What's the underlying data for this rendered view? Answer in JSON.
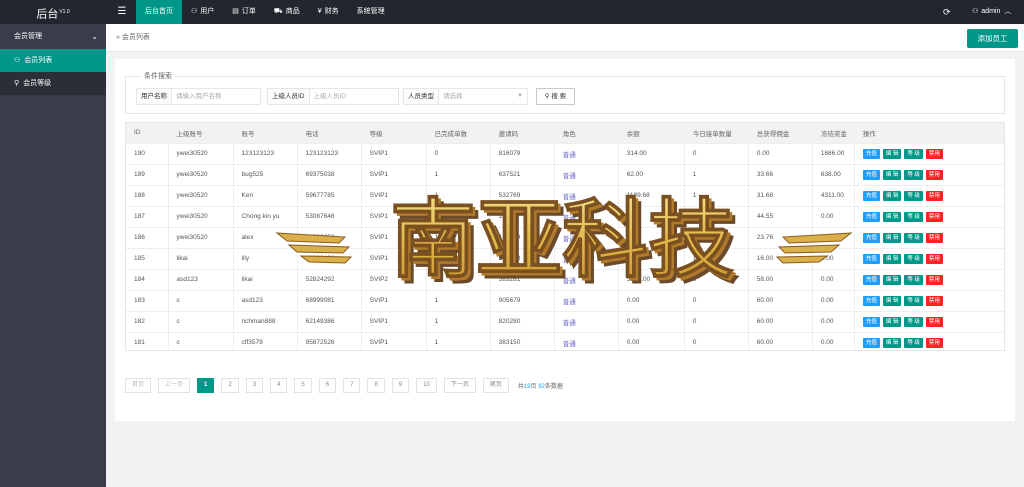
{
  "brand": {
    "name": "后台",
    "version": "V1.0"
  },
  "topnav": {
    "toggle_icon": "menu-icon",
    "items": [
      {
        "label": "后台首页",
        "active": true,
        "icon": ""
      },
      {
        "label": "用户",
        "active": false,
        "icon": "user-icon"
      },
      {
        "label": "订单",
        "active": false,
        "icon": "doc-icon"
      },
      {
        "label": "商品",
        "active": false,
        "icon": "cart-icon"
      },
      {
        "label": "财务",
        "active": false,
        "icon": "yen-icon"
      },
      {
        "label": "系统管理",
        "active": false,
        "icon": ""
      }
    ],
    "refresh_icon": "refresh-icon",
    "user": "admin"
  },
  "sidebar": {
    "group": "会员管理",
    "items": [
      {
        "label": "会员列表",
        "active": true,
        "icon": "user-icon"
      },
      {
        "label": "会员等级",
        "active": false,
        "icon": "key-icon"
      }
    ]
  },
  "breadcrumb": {
    "sep": "»",
    "label": "会员列表"
  },
  "toolbar": {
    "add_label": "添加员工"
  },
  "search": {
    "legend": "条件搜索",
    "username_label": "用户名称",
    "username_placeholder": "请输入用户名称",
    "parent_label": "上级人员ID",
    "parent_placeholder": "上级人员ID",
    "type_label": "人员类型",
    "type_placeholder": "请选择",
    "search_button": "搜 索"
  },
  "table": {
    "columns": [
      "ID",
      "上级账号",
      "账号",
      "电话",
      "等级",
      "已完成单数",
      "邀请码",
      "角色",
      "余额",
      "今日接单数量",
      "总获得佣金",
      "冻结资金",
      "操作"
    ],
    "actions": [
      "充值",
      "编 辑",
      "等 级",
      "禁用"
    ],
    "rows": [
      [
        "190",
        "ywei30520",
        "123123123",
        "123123123",
        "SVIP1",
        "0",
        "816079",
        "普通",
        "314.00",
        "0",
        "0.00",
        "1686.00"
      ],
      [
        "189",
        "ywei30520",
        "bug525",
        "69375038",
        "SVIP1",
        "1",
        "637521",
        "普通",
        "62.00",
        "1",
        "33.66",
        "638.00"
      ],
      [
        "188",
        "ywei30520",
        "Ken",
        "59677785",
        "SVIP1",
        "1",
        "532769",
        "普通",
        "1189.68",
        "1",
        "31.68",
        "4311.00"
      ],
      [
        "187",
        "ywei30520",
        "Chong kin yu",
        "53087646",
        "SVIP1",
        "3",
        "111111",
        "普通",
        "0.00",
        "3",
        "44.55",
        "0.00"
      ],
      [
        "186",
        "ywei30520",
        "alex",
        "53700050",
        "SVIP1",
        "1",
        "180039",
        "普通",
        "0.00",
        "1",
        "23.76",
        "0.00"
      ],
      [
        "185",
        "likai",
        "lily",
        "68838131",
        "SVIP1",
        "1",
        "246928",
        "普通",
        "19.86",
        "1",
        "16.00",
        "0.00"
      ],
      [
        "184",
        "asd123",
        "likai",
        "52824292",
        "SVIP2",
        "3",
        "583281",
        "普通",
        "5570.00",
        "3",
        "58.00",
        "0.00"
      ],
      [
        "183",
        "c",
        "asd123",
        "68999081",
        "SVIP1",
        "1",
        "905679",
        "普通",
        "0.00",
        "0",
        "60.00",
        "0.00"
      ],
      [
        "182",
        "c",
        "richman888",
        "62149386",
        "SVIP1",
        "1",
        "820280",
        "普通",
        "0.00",
        "0",
        "60.00",
        "0.00"
      ],
      [
        "181",
        "c",
        "cff3579",
        "95872526",
        "SVIP1",
        "1",
        "383150",
        "普通",
        "0.00",
        "0",
        "60.00",
        "0.00"
      ]
    ],
    "scroll_fraction": 0.475
  },
  "pager": {
    "first": "首页",
    "prev": "上一页",
    "pages": [
      "1",
      "2",
      "3",
      "4",
      "5",
      "6",
      "7",
      "8",
      "9",
      "10"
    ],
    "current": "1",
    "next": "下一页",
    "last": "尾页",
    "info_prefix": "共",
    "pages_total": "19",
    "info_mid": "页 ",
    "rows_total": "92",
    "info_suffix": "条数据"
  },
  "watermark": {
    "text": "南亚科技",
    "colors": {
      "front": "#e8c85a",
      "side": "#b07a2a",
      "shadow": "#6a4a2a"
    }
  },
  "colors": {
    "accent": "#009688",
    "topbar": "#23262e",
    "sidebar": "#393d49",
    "blue": "#1e9fff",
    "red": "#ff2222"
  }
}
